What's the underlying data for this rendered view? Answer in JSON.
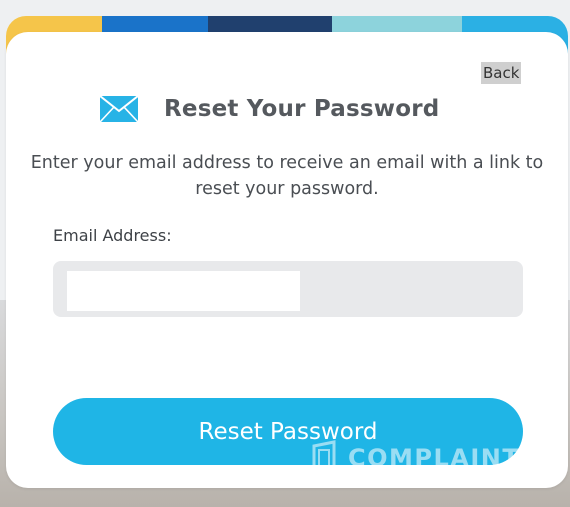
{
  "header": {
    "back_label": "Back",
    "title": "Reset Your Password",
    "icon": "envelope-icon"
  },
  "form": {
    "description": "Enter your email address to receive an email with a link to reset your password.",
    "email_label": "Email Address:",
    "email_value": "",
    "submit_label": "Reset Password"
  },
  "watermark": {
    "text": "COMPLAINTS"
  },
  "colors": {
    "accent": "#1fb5e6",
    "stripe_yellow": "#f5c54a",
    "stripe_blue": "#1a73c9",
    "stripe_navy": "#20406e",
    "stripe_teal": "#8dd3dc",
    "stripe_cyan": "#2bb0e4"
  }
}
